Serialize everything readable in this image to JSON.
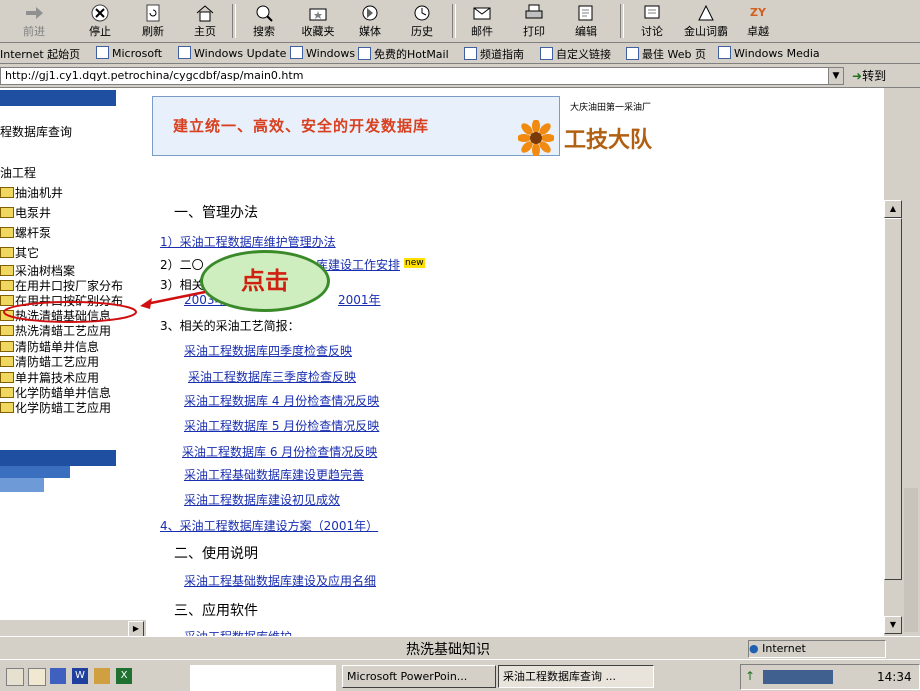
{
  "toolbar": {
    "back": "前进",
    "stop": "停止",
    "refresh": "刷新",
    "home": "主页",
    "search": "搜索",
    "favorites": "收藏夹",
    "media": "媒体",
    "history": "历史",
    "mail": "邮件",
    "print": "打印",
    "edit": "编辑",
    "discuss": "讨论",
    "jinshan": "金山词霸",
    "zhuoyue": "卓越",
    "zhuoyue_logo": "ZY"
  },
  "links": [
    "Internet 起始页",
    "Microsoft",
    "Windows Update",
    "Windows",
    "免费的HotMail",
    "频道指南",
    "自定义链接",
    "最佳 Web 页",
    "Windows Media"
  ],
  "address": {
    "url": "http://gj1.cy1.dqyt.petrochina/cygcdbf/asp/main0.htm",
    "go": "转到"
  },
  "left": {
    "heading": "程数据库查询",
    "items": [
      "油工程",
      "抽油机井",
      "电泵井",
      "螺杆泵",
      "其它",
      "采油树档案",
      "在用井口按厂家分布",
      "在用井口按矿别分布",
      "热洗清蜡基础信息",
      "热洗清蜡工艺应用",
      "清防蜡单井信息",
      "清防蜡工艺应用",
      "单井篇技术应用",
      "化学防蜡单井信息",
      "化学防蜡工艺应用"
    ]
  },
  "banner": {
    "slogan": "建立统一、高效、安全的开发数据库",
    "org": "大庆油田第一采油厂",
    "team": "工技大队"
  },
  "main": {
    "sec1": "一、管理办法",
    "item1": "1）采油工程数据库维护管理办法",
    "item2_pre": "2）二〇",
    "item2_link": "库建设工作安排",
    "item2_new": "new",
    "item3_pre": "3）相关",
    "year1": "2003年",
    "year2": "2001年",
    "item4_head": "3、相关的采油工艺简报：",
    "briefs": [
      "采油工程数据库四季度检查反映",
      "采油工程数据库三季度检查反映",
      "采油工程数据库 4 月份检查情况反映",
      "采油工程数据库 5 月份检查情况反映",
      "采油工程数据库 6 月份检查情况反映",
      "采油工程基础数据库建设更趋完善",
      "采油工程数据库建设初见成效"
    ],
    "item5": "4、采油工程数据库建设方案（2001年）",
    "sec2": "二、使用说明",
    "usage": "采油工程基础数据库建设及应用名细",
    "sec3": "三、应用软件",
    "software": "采油工程数据库维护"
  },
  "callout": "点击",
  "status": {
    "caption": "热洗基础知识",
    "zone": "Internet"
  },
  "taskbar": {
    "tasks": [
      "Microsoft PowerPoin...",
      "采油工程数据库查询 ..."
    ],
    "clock": "14:34"
  }
}
